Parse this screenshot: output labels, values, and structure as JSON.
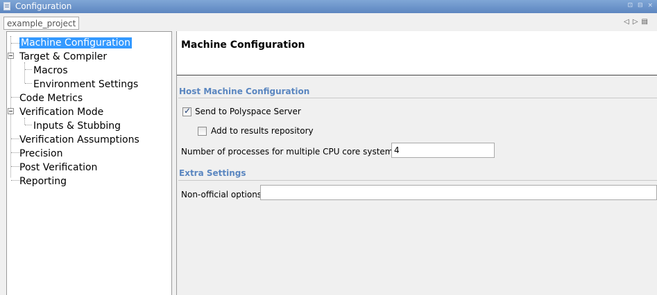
{
  "window": {
    "title": "Configuration",
    "buttons": "⊡ ⊟ ×"
  },
  "project_tab": {
    "label": "example_project"
  },
  "tab_nav": {
    "prev": "◁",
    "next": "▷",
    "menu": "▤"
  },
  "tree": {
    "items": [
      {
        "label": "Machine Configuration",
        "selected": true
      },
      {
        "label": "Target & Compiler",
        "expandable": true
      },
      {
        "label": "Macros"
      },
      {
        "label": "Environment Settings"
      },
      {
        "label": "Code Metrics"
      },
      {
        "label": "Verification Mode",
        "expandable": true
      },
      {
        "label": "Inputs & Stubbing"
      },
      {
        "label": "Verification Assumptions"
      },
      {
        "label": "Precision"
      },
      {
        "label": "Post Verification"
      },
      {
        "label": "Reporting"
      }
    ]
  },
  "main": {
    "title": "Machine Configuration",
    "host_section": "Host Machine Configuration",
    "send_server": {
      "label": "Send to Polyspace Server",
      "checked": true
    },
    "add_repo": {
      "label": "Add to results repository",
      "checked": false
    },
    "processes": {
      "label": "Number of processes for multiple CPU core systems",
      "value": "4"
    },
    "extra_section": "Extra Settings",
    "nonofficial": {
      "label": "Non-official options",
      "value": ""
    }
  },
  "colors": {
    "selection": "#3399ff",
    "section_header": "#5a86c0",
    "titlebar": "#6a92c9"
  }
}
